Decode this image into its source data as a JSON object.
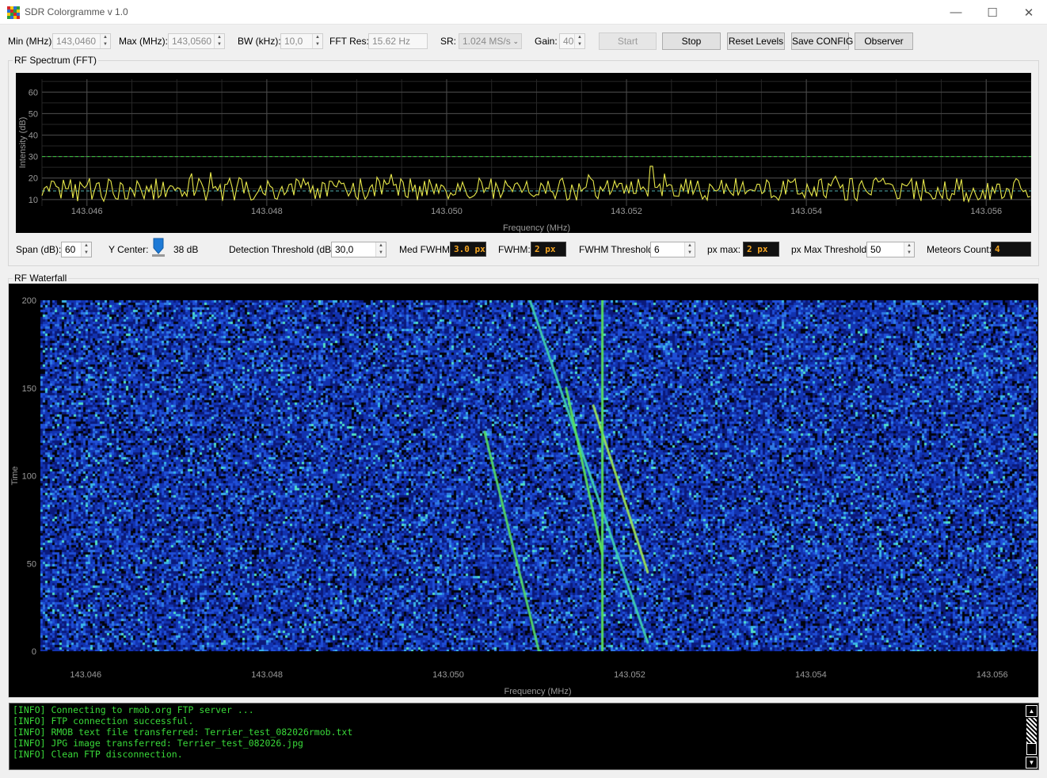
{
  "window": {
    "title": "SDR Colorgramme v 1.0",
    "minimize_glyph": "—",
    "maximize_glyph": "☐",
    "close_glyph": "✕",
    "icon": "app-icon"
  },
  "toolbar": {
    "min_label": "Min (MHz):",
    "min_value": "143,0460",
    "max_label": "Max (MHz):",
    "max_value": "143,0560",
    "bw_label": "BW (kHz):",
    "bw_value": "10,0",
    "fftres_label": "FFT Res:",
    "fftres_value": "15.62 Hz",
    "sr_label": "SR:",
    "sr_value": "1.024 MS/s",
    "gain_label": "Gain:",
    "gain_value": "40",
    "start_label": "Start",
    "stop_label": "Stop",
    "reset_label": "Reset Levels",
    "save_label": "Save CONFIG",
    "observer_label": "Observer"
  },
  "spectrum": {
    "group_title": "RF Spectrum (FFT)",
    "ylabel": "Intensity (dB)",
    "xlabel": "Frequency (MHz)",
    "yticks": [
      "60",
      "50",
      "40",
      "30",
      "20",
      "10"
    ],
    "xticks": [
      "143.046",
      "143.048",
      "143.050",
      "143.052",
      "143.054",
      "143.056"
    ],
    "detection_threshold_db": 30,
    "median_level_db": 14,
    "noise_floor_db": 13,
    "colors": {
      "trace": "#e8e84a",
      "threshold": "#36c93c",
      "median": "#4fb0b0",
      "grid": "#3a3a3a"
    }
  },
  "controls": {
    "span_label": "Span (dB):",
    "span_value": "60",
    "ycenter_label": "Y Center:",
    "ycenter_value": "38 dB",
    "det_label": "Detection Threshold (dB):",
    "det_value": "30,0",
    "medfwhm_label": "Med FWHM:",
    "medfwhm_value": "3.0 px",
    "fwhm_label": "FWHM:",
    "fwhm_value": "2 px",
    "fwhmthr_label": "FWHM Threshold:",
    "fwhmthr_value": "6",
    "pxmax_label": "px max:",
    "pxmax_value": "2 px",
    "pxmaxthr_label": "px Max Threshold:",
    "pxmaxthr_value": "50",
    "meteors_label": "Meteors Count:",
    "meteors_value": "4"
  },
  "waterfall": {
    "group_title": "RF Waterfall",
    "ylabel": "Time",
    "xlabel": "Frequency (MHz)",
    "yticks": [
      "200",
      "150",
      "100",
      "50",
      "0"
    ],
    "xticks": [
      "143.046",
      "143.048",
      "143.050",
      "143.052",
      "143.054",
      "143.056"
    ],
    "traces": [
      {
        "f0": 143.0504,
        "t0": 125,
        "f1": 143.051,
        "t1": 0,
        "color": "#52d86a"
      },
      {
        "f0": 143.0509,
        "t0": 200,
        "f1": 143.0522,
        "t1": 5,
        "color": "#3fd0b0"
      },
      {
        "f0": 143.0513,
        "t0": 150,
        "f1": 143.0517,
        "t1": 55,
        "color": "#5ae060"
      },
      {
        "f0": 143.0516,
        "t0": 140,
        "f1": 143.0522,
        "t1": 45,
        "color": "#9be35a"
      },
      {
        "f0": 143.0517,
        "t0": 200,
        "f1": 143.0517,
        "t1": 0,
        "color": "#58e05c"
      }
    ]
  },
  "log": {
    "lines": [
      "[INFO] Connecting to rmob.org FTP server ...",
      "[INFO] FTP connection successful.",
      "[INFO] RMOB text file transferred: Terrier_test_082026rmob.txt",
      "[INFO] JPG image transferred: Terrier_test_082026.jpg",
      "[INFO] Clean FTP disconnection."
    ]
  }
}
